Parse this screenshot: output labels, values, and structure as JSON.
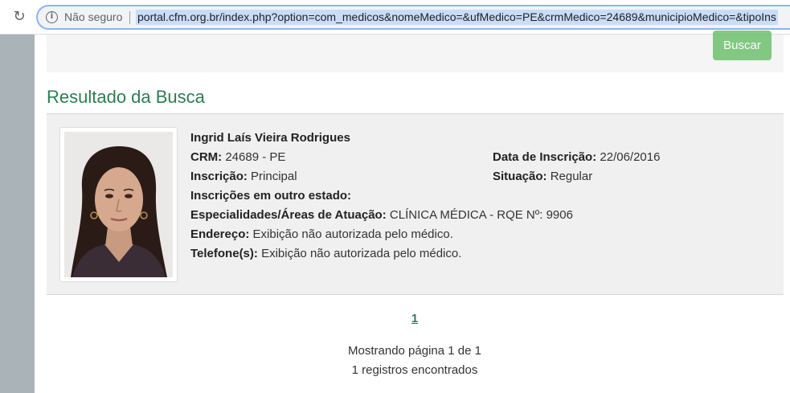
{
  "browser": {
    "security_label": "Não seguro",
    "url": "portal.cfm.org.br/index.php?option=com_medicos&nomeMedico=&ufMedico=PE&crmMedico=24689&municipioMedico=&tipoIns"
  },
  "search_form": {
    "button_label": "Buscar"
  },
  "results": {
    "title": "Resultado da Busca",
    "doctor": {
      "name": "Ingrid Laís Vieira Rodrigues",
      "crm_label": "CRM:",
      "crm_value": "24689 - PE",
      "registration_date_label": "Data de Inscrição:",
      "registration_date_value": "22/06/2016",
      "inscription_label": "Inscrição:",
      "inscription_value": "Principal",
      "status_label": "Situação:",
      "status_value": "Regular",
      "other_state_label": "Inscrições em outro estado:",
      "specialties_label": "Especialidades/Áreas de Atuação:",
      "specialties_value": "CLÍNICA MÉDICA - RQE Nº: 9906",
      "address_label": "Endereço:",
      "address_value": "Exibição não autorizada pelo médico.",
      "phone_label": "Telefone(s):",
      "phone_value": "Exibição não autorizada pelo médico."
    }
  },
  "pagination": {
    "current_page": "1",
    "page_info": "Mostrando página 1 de 1",
    "records_info": "1 registros encontrados"
  },
  "colors": {
    "accent_green": "#2e7d51",
    "button_green": "#5cb85c"
  }
}
